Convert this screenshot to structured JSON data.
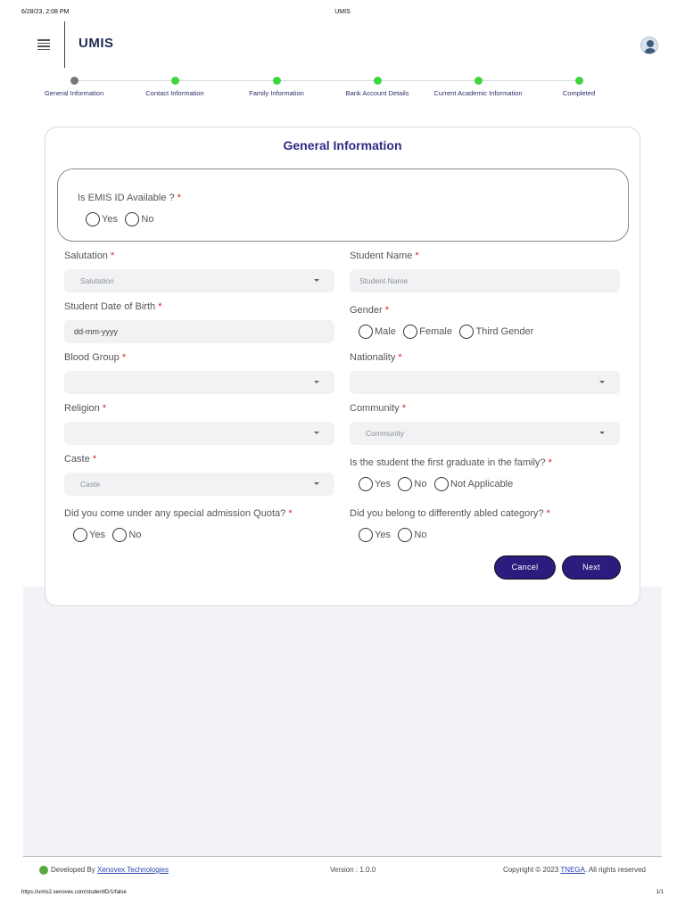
{
  "print": {
    "datetime": "6/28/23, 2:08 PM",
    "doc_title": "UMIS",
    "url": "https://umis2.xenovex.com/studentID/1/false",
    "page": "1/1"
  },
  "header": {
    "app_title": "UMIS",
    "menu_icon": "hamburger-menu-icon",
    "avatar_icon": "user-avatar-icon"
  },
  "stepper": {
    "steps": [
      {
        "label": "General Information",
        "state": "current",
        "color": "#777777"
      },
      {
        "label": "Contact Information",
        "state": "pending",
        "color": "#3dd63d"
      },
      {
        "label": "Family Information",
        "state": "pending",
        "color": "#3dd63d"
      },
      {
        "label": "Bank Account Details",
        "state": "pending",
        "color": "#3dd63d"
      },
      {
        "label": "Current Academic Information",
        "state": "pending",
        "color": "#3dd63d"
      },
      {
        "label": "Completed",
        "state": "pending",
        "color": "#3dd63d"
      }
    ]
  },
  "form": {
    "title": "General Information",
    "emis": {
      "question": "Is EMIS ID Available ?",
      "options": [
        "Yes",
        "No"
      ]
    },
    "salutation": {
      "label": "Salutation",
      "placeholder": "Salutation"
    },
    "student_name": {
      "label": "Student Name",
      "placeholder": "Student Name"
    },
    "dob": {
      "label": "Student Date of Birth",
      "value": "dd-mm-yyyy"
    },
    "gender": {
      "label": "Gender",
      "options": [
        "Male",
        "Female",
        "Third Gender"
      ]
    },
    "blood_group": {
      "label": "Blood Group",
      "value": ""
    },
    "nationality": {
      "label": "Nationality",
      "value": ""
    },
    "religion": {
      "label": "Religion",
      "value": ""
    },
    "community": {
      "label": "Community",
      "placeholder": "Community"
    },
    "caste": {
      "label": "Caste",
      "placeholder": "Caste"
    },
    "first_graduate": {
      "label": "Is the student the first graduate in the family?",
      "options": [
        "Yes",
        "No",
        "Not Applicable"
      ]
    },
    "special_quota": {
      "label": "Did you come under any special admission Quota?",
      "options": [
        "Yes",
        "No"
      ]
    },
    "differently_abled": {
      "label": "Did you belong to differently abled category?",
      "options": [
        "Yes",
        "No"
      ]
    },
    "required_mark": "*",
    "cancel_label": "Cancel",
    "next_label": "Next"
  },
  "footer": {
    "developed_by": "Developed By",
    "developer": "Xenovex Technologies",
    "version": "Version : 1.0.0",
    "copyright_prefix": "Copyright © 2023",
    "org": "TNEGA",
    "copyright_suffix": ". All rights reserved"
  },
  "colors": {
    "primary": "#2d1c7e",
    "title": "#2e2a86",
    "step_done": "#3dd63d",
    "step_current": "#777777",
    "required": "#dd2222"
  }
}
